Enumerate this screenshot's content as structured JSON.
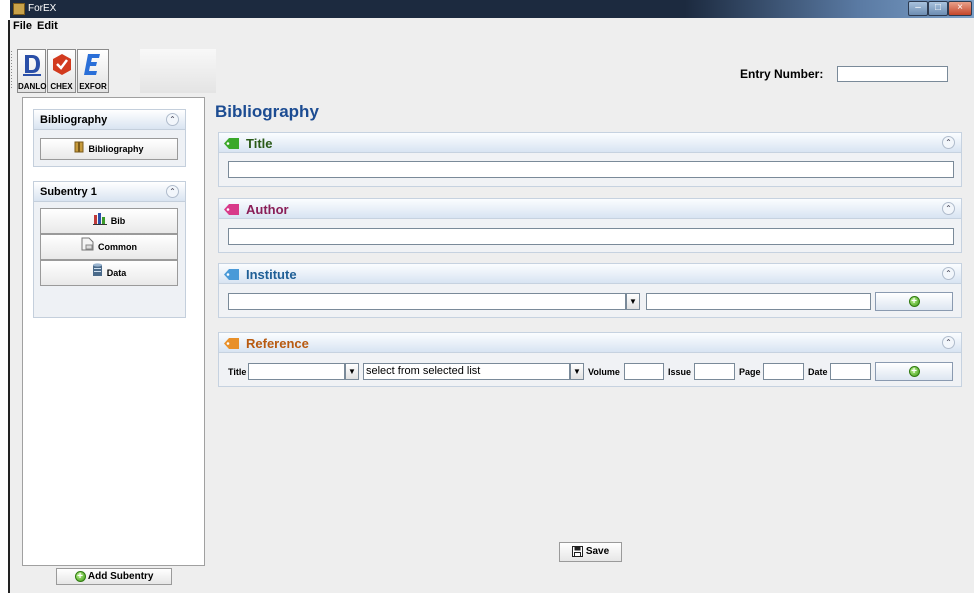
{
  "window": {
    "title": "ForEX"
  },
  "menu": {
    "file": "File",
    "edit": "Edit"
  },
  "toolbar": {
    "danlo": "DANLO",
    "chex": "CHEX",
    "exfor": "EXFOR"
  },
  "entry": {
    "label": "Entry Number:",
    "value": ""
  },
  "sidebar": {
    "bibliography_pane": {
      "title": "Bibliography",
      "button": "Bibliography"
    },
    "subentry_pane": {
      "title": "Subentry 1",
      "buttons": [
        "Bib",
        "Common",
        "Data"
      ]
    },
    "add_subentry": "Add Subentry"
  },
  "main": {
    "heading": "Bibliography",
    "sections": {
      "title": {
        "label": "Title",
        "value": ""
      },
      "author": {
        "label": "Author",
        "value": ""
      },
      "institute": {
        "label": "Institute",
        "combo_value": "",
        "text_value": ""
      },
      "reference": {
        "label": "Reference",
        "title_label": "Title",
        "title_value": "",
        "list_value": "select from selected list",
        "volume_label": "Volume",
        "issue_label": "Issue",
        "page_label": "Page",
        "date_label": "Date"
      }
    },
    "save": "Save"
  },
  "colors": {
    "heading": "#1c4c92",
    "title_section": "#2a5a18",
    "author_section": "#8a1e57",
    "institute_section": "#1f5f96",
    "reference_section": "#b85a10"
  }
}
